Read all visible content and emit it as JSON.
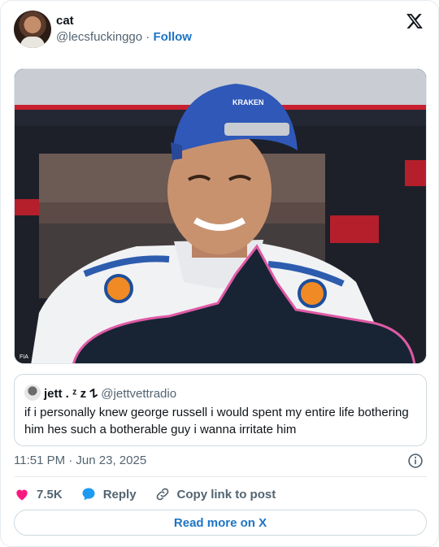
{
  "author": {
    "name": "cat",
    "handle": "@lecsfuckinggo",
    "separator": "·",
    "follow_label": "Follow"
  },
  "media": {
    "cap_brand": "KRAKEN",
    "sponsor": "Gulf",
    "photo_caption": "FIA"
  },
  "quote": {
    "name": "jett . ᶻ z 𐰁",
    "handle": "@jettvettradio",
    "text": "if i personally knew george russell i would spent my entire life bothering him hes such a botherable guy i wanna irritate him"
  },
  "timestamp": "11:51 PM · Jun 23, 2025",
  "actions": {
    "likes": "7.5K",
    "reply_label": "Reply",
    "copy_label": "Copy link to post"
  },
  "read_more_label": "Read more on X",
  "colors": {
    "like": "#f91880",
    "reply": "#1d9bf0",
    "link": "#1d74c4",
    "muted": "#536471",
    "overlay_shape": "#182433",
    "overlay_border": "#e05aa6"
  },
  "icons": [
    "x-logo-icon",
    "info-icon",
    "heart-icon",
    "reply-bubble-icon",
    "link-icon"
  ]
}
